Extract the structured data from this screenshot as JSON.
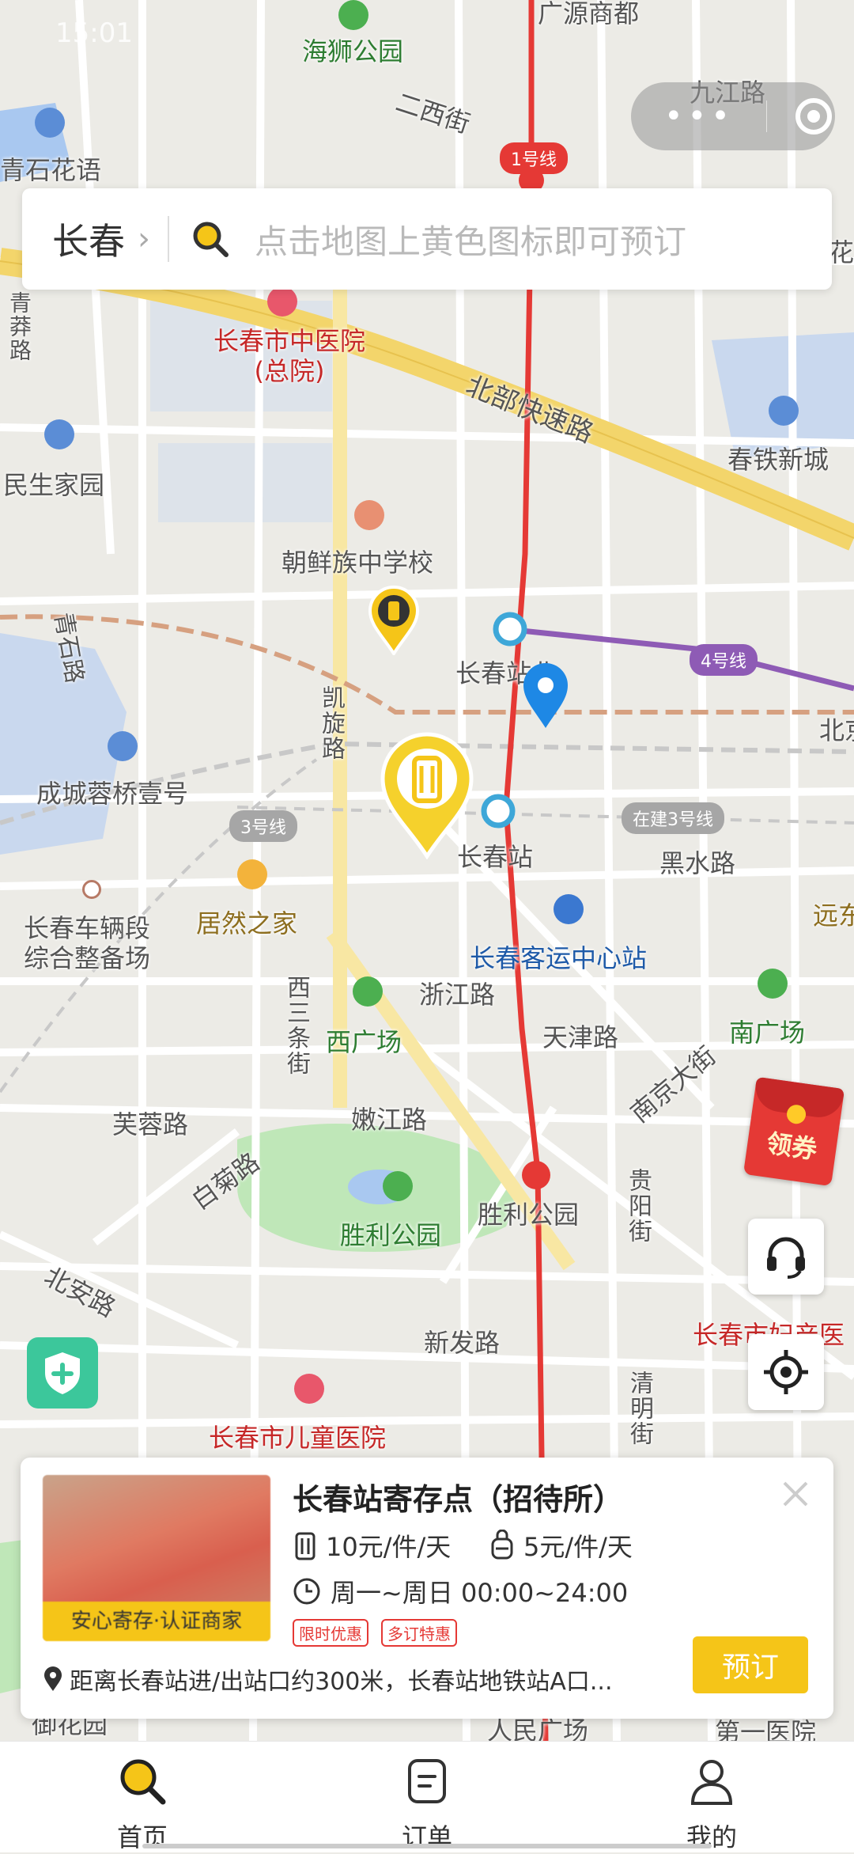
{
  "status_bar": {
    "time": "15:01"
  },
  "search": {
    "city": "长春",
    "chevron": "›",
    "placeholder": "点击地图上黄色图标即可预订"
  },
  "map": {
    "labels": {
      "haishi_park": "海狮公园",
      "erxi_street": "二西街",
      "jiujiang_road": "九江路",
      "yuanshangdu": "广源商都",
      "qingshi_huayu": "青石花语",
      "hua": "花",
      "qinglv_road": "青莽路",
      "zhongyi_hospital": "长春市中医院(总院)",
      "beibu_expressway": "北部快速路",
      "chuntie_xincheng": "春铁新城",
      "minsheng_jiayuan": "民生家园",
      "chaoxianzu_school": "朝鲜族中学校",
      "qingshi_road": "青石路",
      "changchun_north": "长春站北",
      "kaixuan_road": "凯旋路",
      "bei": "北京",
      "chengcheng_rongqiao": "成城蓉桥壹号",
      "changchun_station": "长春站",
      "heishui_road": "黑水路",
      "juran_zhijia": "居然之家",
      "yuandong": "远东",
      "rolling_depot": "长春车辆段综合整备场",
      "bus_center": "长春客运中心站",
      "xisan_tiaojie": "西三条街",
      "zhejiang_road": "浙江路",
      "xi_guangchang": "西广场",
      "tianjin_road": "天津路",
      "nanjing_dajie": "南京大街",
      "nan_guangchang": "南广场",
      "furong_road": "芙蓉路",
      "nenjiang_road": "嫩江路",
      "baiju_road": "白菊路",
      "shengli_park": "胜利公园",
      "shengli_park_station": "胜利公园",
      "guiyang_street": "贵阳街",
      "beian_road": "北安路",
      "xinfa_road": "新发路",
      "fuchan_hospital": "长春市妇产医",
      "ertong_hospital": "长春市儿童医院",
      "qingming_street": "清明街",
      "yuhuayuan": "御花园",
      "renmin_guangchang": "人民广场",
      "diyi_hospital": "第一医院"
    },
    "line_badges": {
      "line1": "1号线",
      "line4": "4号线",
      "line3": "3号线",
      "line3_building": "在建3号线"
    }
  },
  "coupon": {
    "label": "领券"
  },
  "card": {
    "thumb_caption": "安心寄存·认证商家",
    "title": "长春站寄存点（招待所）",
    "price_large": "10元/件/天",
    "price_small": "5元/件/天",
    "hours": "周一~周日 00:00~24:00",
    "tags": [
      "限时优惠",
      "多订特惠"
    ],
    "address": "距离长春站进/出站口约300米，长春站地铁站A口...",
    "book_label": "预订"
  },
  "tabs": [
    {
      "label": "首页",
      "icon": "search-icon"
    },
    {
      "label": "订单",
      "icon": "order-icon"
    },
    {
      "label": "我的",
      "icon": "user-icon"
    }
  ],
  "colors": {
    "accent": "#f5c518",
    "line1": "#e53935",
    "line4": "#8e5bb5",
    "pin_blue": "#1e88e5"
  }
}
